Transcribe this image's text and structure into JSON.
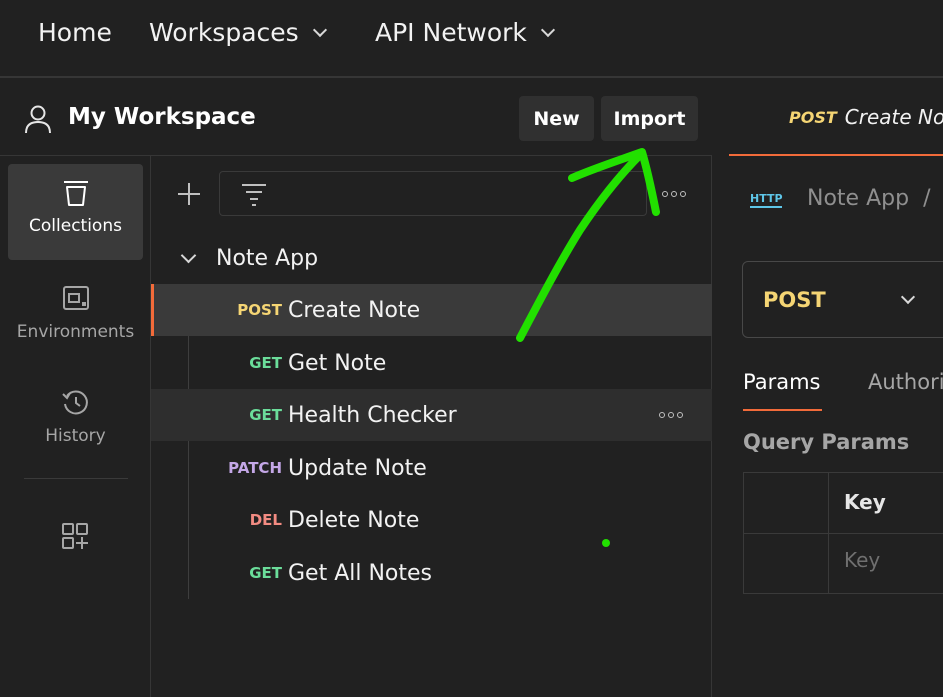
{
  "topnav": {
    "home": "Home",
    "workspaces": "Workspaces",
    "api_network": "API Network"
  },
  "workspace": {
    "title": "My Workspace",
    "new_label": "New",
    "import_label": "Import"
  },
  "rail": {
    "items": [
      {
        "label": "Collections",
        "icon": "collections-icon",
        "active": true
      },
      {
        "label": "Environments",
        "icon": "environments-icon",
        "active": false
      },
      {
        "label": "History",
        "icon": "history-icon",
        "active": false
      }
    ]
  },
  "collection": {
    "name": "Note App",
    "requests": [
      {
        "method": "POST",
        "name": "Create Note",
        "color": "#f5d574"
      },
      {
        "method": "GET",
        "name": "Get Note",
        "color": "#6bdd9a"
      },
      {
        "method": "GET",
        "name": "Health Checker",
        "color": "#6bdd9a"
      },
      {
        "method": "PATCH",
        "name": "Update Note",
        "color": "#c4a7e7"
      },
      {
        "method": "DEL",
        "name": "Delete Note",
        "color": "#f28b82"
      },
      {
        "method": "GET",
        "name": "Get All Notes",
        "color": "#6bdd9a"
      }
    ]
  },
  "request_tab": {
    "method": "POST",
    "name": "Create Not"
  },
  "breadcrumb": {
    "protocol": "HTTP",
    "collection": "Note App",
    "separator": "/"
  },
  "editor": {
    "method": "POST",
    "tabs": [
      "Params",
      "Authori"
    ],
    "query_params_title": "Query Params",
    "key_header": "Key",
    "key_placeholder": "Key"
  },
  "colors": {
    "accent": "#f26b3a",
    "post": "#f5d574",
    "annotation": "#22e000"
  }
}
